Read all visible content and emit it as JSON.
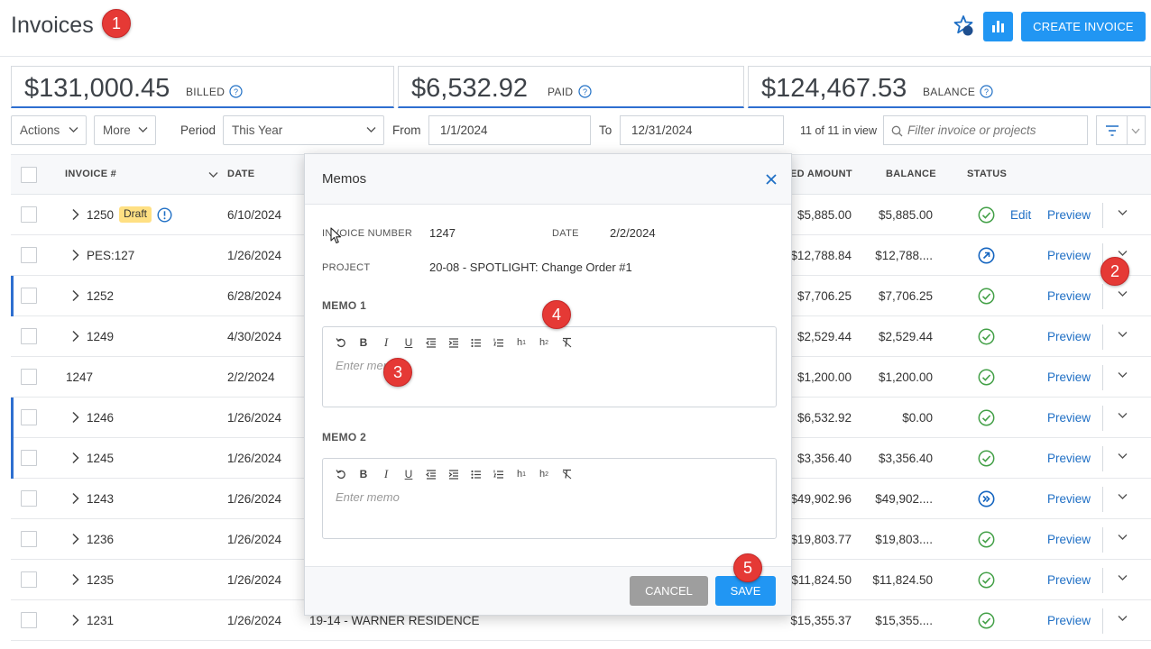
{
  "header": {
    "title": "Invoices",
    "create_label": "CREATE INVOICE"
  },
  "summary": {
    "billed_amount": "$131,000.45",
    "billed_label": "BILLED",
    "paid_amount": "$6,532.92",
    "paid_label": "PAID",
    "balance_amount": "$124,467.53",
    "balance_label": "BALANCE",
    "help_glyph": "?"
  },
  "filters": {
    "actions_label": "Actions",
    "more_label": "More",
    "period_label": "Period",
    "period_value": "This Year",
    "from_label": "From",
    "from_value": "1/1/2024",
    "to_label": "To",
    "to_value": "12/31/2024",
    "count_text": "11 of 11 in view",
    "search_placeholder": "Filter invoice or projects"
  },
  "table": {
    "headers": {
      "invoice": "INVOICE #",
      "date": "DATE",
      "billed_amount": "ED AMOUNT",
      "balance": "BALANCE",
      "status": "STATUS"
    },
    "edit_label": "Edit",
    "preview_label": "Preview",
    "rows": [
      {
        "invoice": "1250",
        "draft": "Draft",
        "date": "6/10/2024",
        "project": "",
        "billed": "$5,885.00",
        "balance": "$5,885.00",
        "status": "paid-check-icon"
      },
      {
        "invoice": "PES:127",
        "date": "1/26/2024",
        "project": "",
        "billed": "$12,788.84",
        "balance": "$12,788....",
        "status": "sent-arrow-icon"
      },
      {
        "invoice": "1252",
        "date": "6/28/2024",
        "project": "",
        "billed": "$7,706.25",
        "balance": "$7,706.25",
        "status": "paid-check-icon"
      },
      {
        "invoice": "1249",
        "date": "4/30/2024",
        "project": "",
        "billed": "$2,529.44",
        "balance": "$2,529.44",
        "status": "paid-check-icon"
      },
      {
        "invoice": "1247",
        "date": "2/2/2024",
        "project": "",
        "billed": "$1,200.00",
        "balance": "$1,200.00",
        "status": "paid-check-icon"
      },
      {
        "invoice": "1246",
        "date": "1/26/2024",
        "project": "",
        "billed": "$6,532.92",
        "balance": "$0.00",
        "status": "paid-check-icon"
      },
      {
        "invoice": "1245",
        "date": "1/26/2024",
        "project": "",
        "billed": "$3,356.40",
        "balance": "$3,356.40",
        "status": "paid-check-icon"
      },
      {
        "invoice": "1243",
        "date": "1/26/2024",
        "project": "",
        "billed": "$49,902.96",
        "balance": "$49,902....",
        "status": "forward-icon"
      },
      {
        "invoice": "1236",
        "date": "1/26/2024",
        "project": "",
        "billed": "$19,803.77",
        "balance": "$19,803....",
        "status": "paid-check-icon"
      },
      {
        "invoice": "1235",
        "date": "1/26/2024",
        "project": "",
        "billed": "$11,824.50",
        "balance": "$11,824.50",
        "status": "paid-check-icon"
      },
      {
        "invoice": "1231",
        "date": "1/26/2024",
        "project": "19-14 - WARNER RESIDENCE",
        "billed": "$15,355.37",
        "balance": "$15,355....",
        "status": "paid-check-icon"
      }
    ]
  },
  "modal": {
    "title": "Memos",
    "invoice_number_label": "INVOICE NUMBER",
    "invoice_number_value": "1247",
    "date_label": "DATE",
    "date_value": "2/2/2024",
    "project_label": "PROJECT",
    "project_value": "20-08 - SPOTLIGHT: Change Order #1",
    "memo1_label": "MEMO 1",
    "memo1_placeholder": "Enter memo",
    "memo2_label": "MEMO 2",
    "memo2_placeholder": "Enter memo",
    "cancel_label": "CANCEL",
    "save_label": "SAVE"
  },
  "callouts": [
    "1",
    "2",
    "3",
    "4",
    "5"
  ],
  "colors": {
    "accent": "#2196f3",
    "callout": "#e53935",
    "link": "#1f6fc5",
    "status_green": "#43a047",
    "status_blue": "#1565c0",
    "draft": "#ffe083"
  }
}
